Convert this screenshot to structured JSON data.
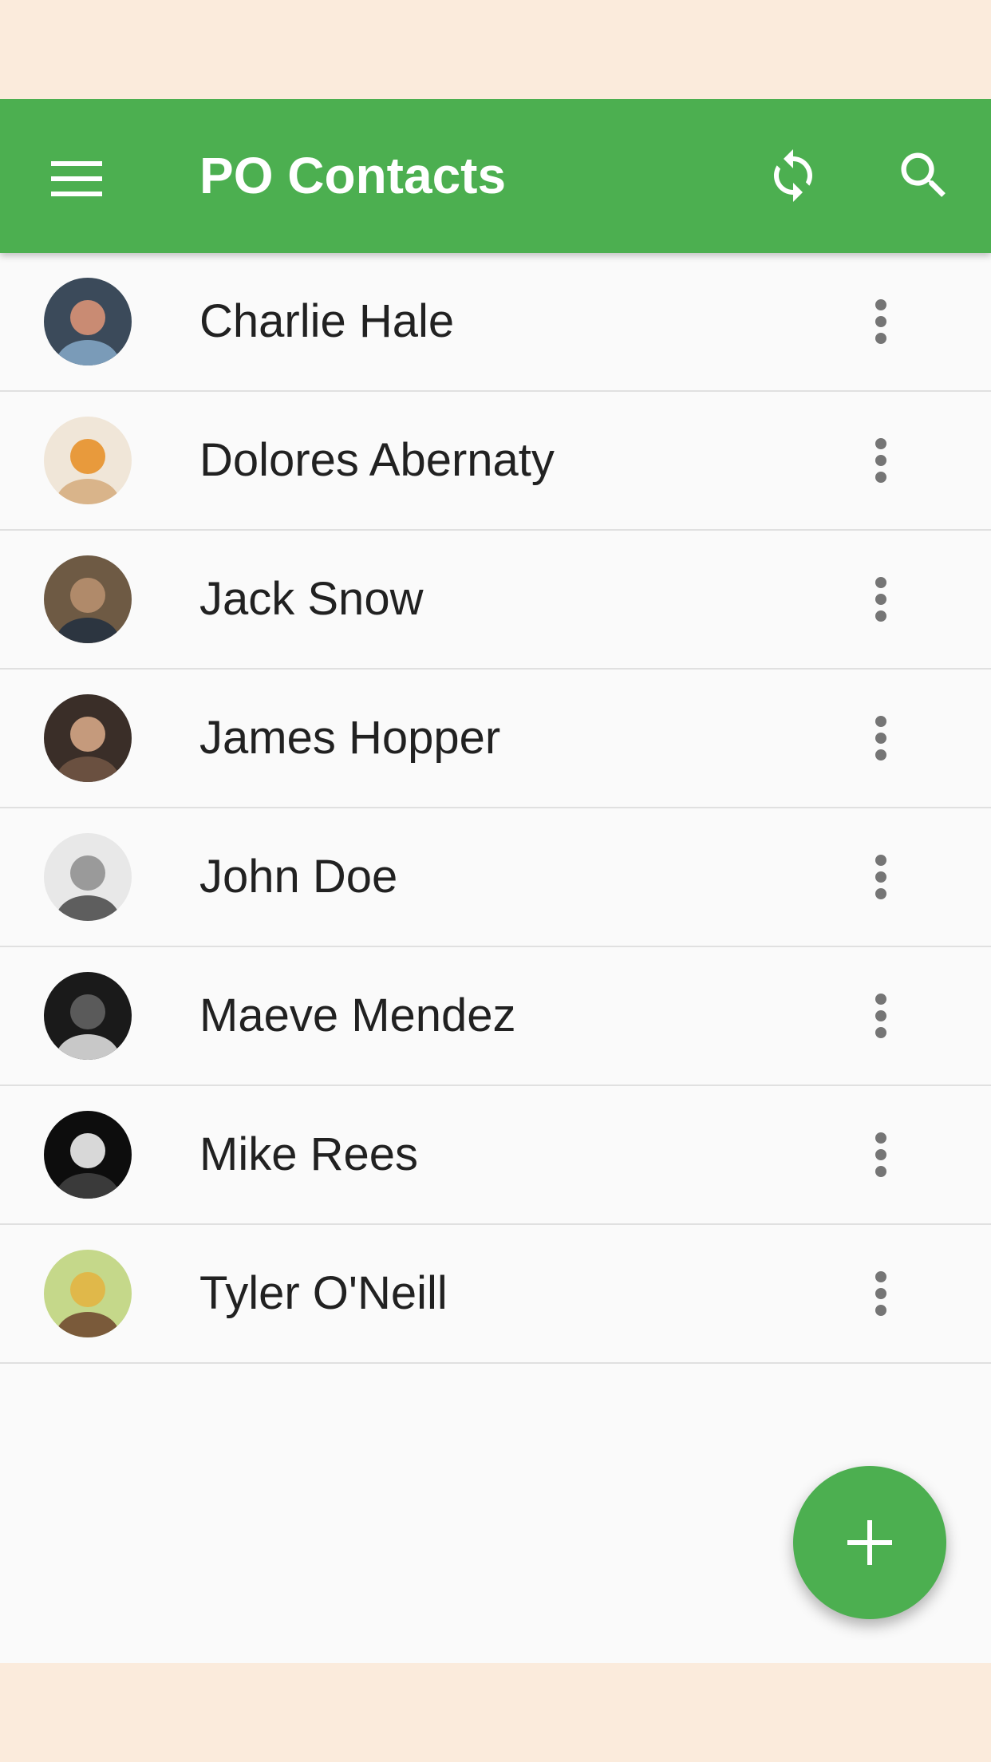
{
  "status_bar": {},
  "toolbar": {
    "title": "PO Contacts",
    "menu_icon": "hamburger-menu-icon",
    "sync_icon": "sync-icon",
    "search_icon": "search-icon",
    "color": "#4caf50"
  },
  "contacts": [
    {
      "name": "Charlie Hale",
      "avatar_colors": [
        "#3b4a5a",
        "#c98b73",
        "#7a9bb8"
      ]
    },
    {
      "name": "Dolores Abernaty",
      "avatar_colors": [
        "#f0e6d8",
        "#e89a3c",
        "#d9b48a"
      ]
    },
    {
      "name": "Jack Snow",
      "avatar_colors": [
        "#6e5a44",
        "#b08a6a",
        "#2c3540"
      ]
    },
    {
      "name": "James Hopper",
      "avatar_colors": [
        "#3a2e28",
        "#c59a7c",
        "#6a5040"
      ]
    },
    {
      "name": "John Doe",
      "avatar_colors": [
        "#e8e8e8",
        "#9a9a9a",
        "#5e5e5e"
      ]
    },
    {
      "name": "Maeve Mendez",
      "avatar_colors": [
        "#1a1a1a",
        "#5a5a5a",
        "#c8c8c8"
      ]
    },
    {
      "name": "Mike Rees",
      "avatar_colors": [
        "#0d0d0d",
        "#d8d8d8",
        "#3a3a3a"
      ]
    },
    {
      "name": "Tyler O'Neill",
      "avatar_colors": [
        "#c5d88a",
        "#e0b84a",
        "#7a5a3a"
      ]
    }
  ],
  "row_more_icon": "more-vertical-icon",
  "fab": {
    "icon": "add-icon",
    "color": "#4caf50"
  }
}
